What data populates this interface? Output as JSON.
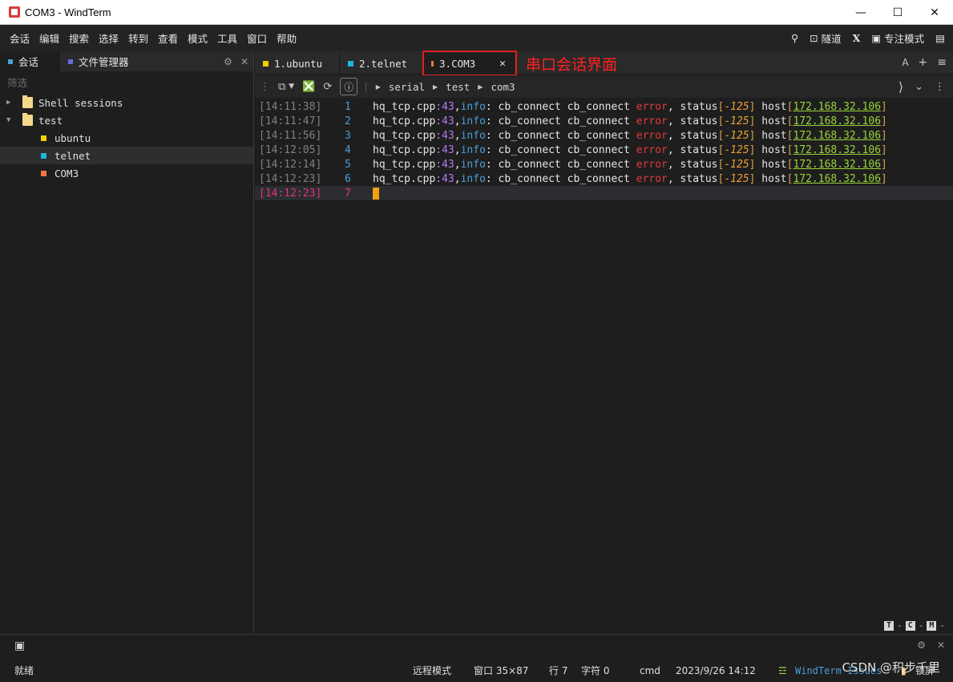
{
  "window": {
    "title": "COM3 - WindTerm"
  },
  "menu": [
    "会话",
    "编辑",
    "搜索",
    "选择",
    "转到",
    "查看",
    "模式",
    "工具",
    "窗口",
    "帮助"
  ],
  "menu_right": {
    "tunnel": "隧道",
    "x": "X",
    "focus_mode": "专注模式"
  },
  "left_panel": {
    "tabs": [
      {
        "label": "会话",
        "color": "#4a9fd8"
      },
      {
        "label": "文件管理器",
        "color": "#6a6adf"
      }
    ],
    "filter_placeholder": "筛选",
    "tree": {
      "shell_sessions": "Shell sessions",
      "test": "test",
      "sessions": [
        {
          "label": "ubuntu",
          "color": "#f5d000"
        },
        {
          "label": "telnet",
          "color": "#1ab8d8"
        },
        {
          "label": "COM3",
          "color": "#f07840"
        }
      ]
    }
  },
  "tabs": [
    {
      "label": "1.ubuntu",
      "color": "#f5d000"
    },
    {
      "label": "2.telnet",
      "color": "#1ab8d8"
    },
    {
      "label": "3.COM3",
      "color": "#f07840"
    }
  ],
  "annotation": "串口会话界面",
  "tabbar_right": {
    "font": "A",
    "add": "+",
    "menu": "≡"
  },
  "breadcrumb": [
    "serial",
    "test",
    "com3"
  ],
  "terminal": {
    "lines": [
      {
        "time": "[14:11:38]",
        "num": "1"
      },
      {
        "time": "[14:11:47]",
        "num": "2"
      },
      {
        "time": "[14:11:56]",
        "num": "3"
      },
      {
        "time": "[14:12:05]",
        "num": "4"
      },
      {
        "time": "[14:12:14]",
        "num": "5"
      },
      {
        "time": "[14:12:23]",
        "num": "6"
      }
    ],
    "line_parts": {
      "file": "hq_tcp.cpp",
      "colon": ":",
      "lineno": "43",
      "comma": ",",
      "info": "info",
      "mid": ": cb_connect cb_connect ",
      "error": "error",
      "status": ", status",
      "lb": "[",
      "code": "-125",
      "rb": "]",
      "host": " host",
      "ip": "172.168.32.106"
    },
    "current": {
      "time": "[14:12:23]",
      "num": "7"
    },
    "modes": [
      "T",
      "C",
      "M"
    ]
  },
  "status": {
    "ready": "就绪",
    "remote_mode": "远程模式",
    "window": "窗口 35×87",
    "row": "行 7",
    "col": "字符 0",
    "shell": "cmd",
    "datetime": "2023/9/26 14:12",
    "app": "WindTerm Issues",
    "lock": "锁屏"
  },
  "watermark": "CSDN @积步千里"
}
